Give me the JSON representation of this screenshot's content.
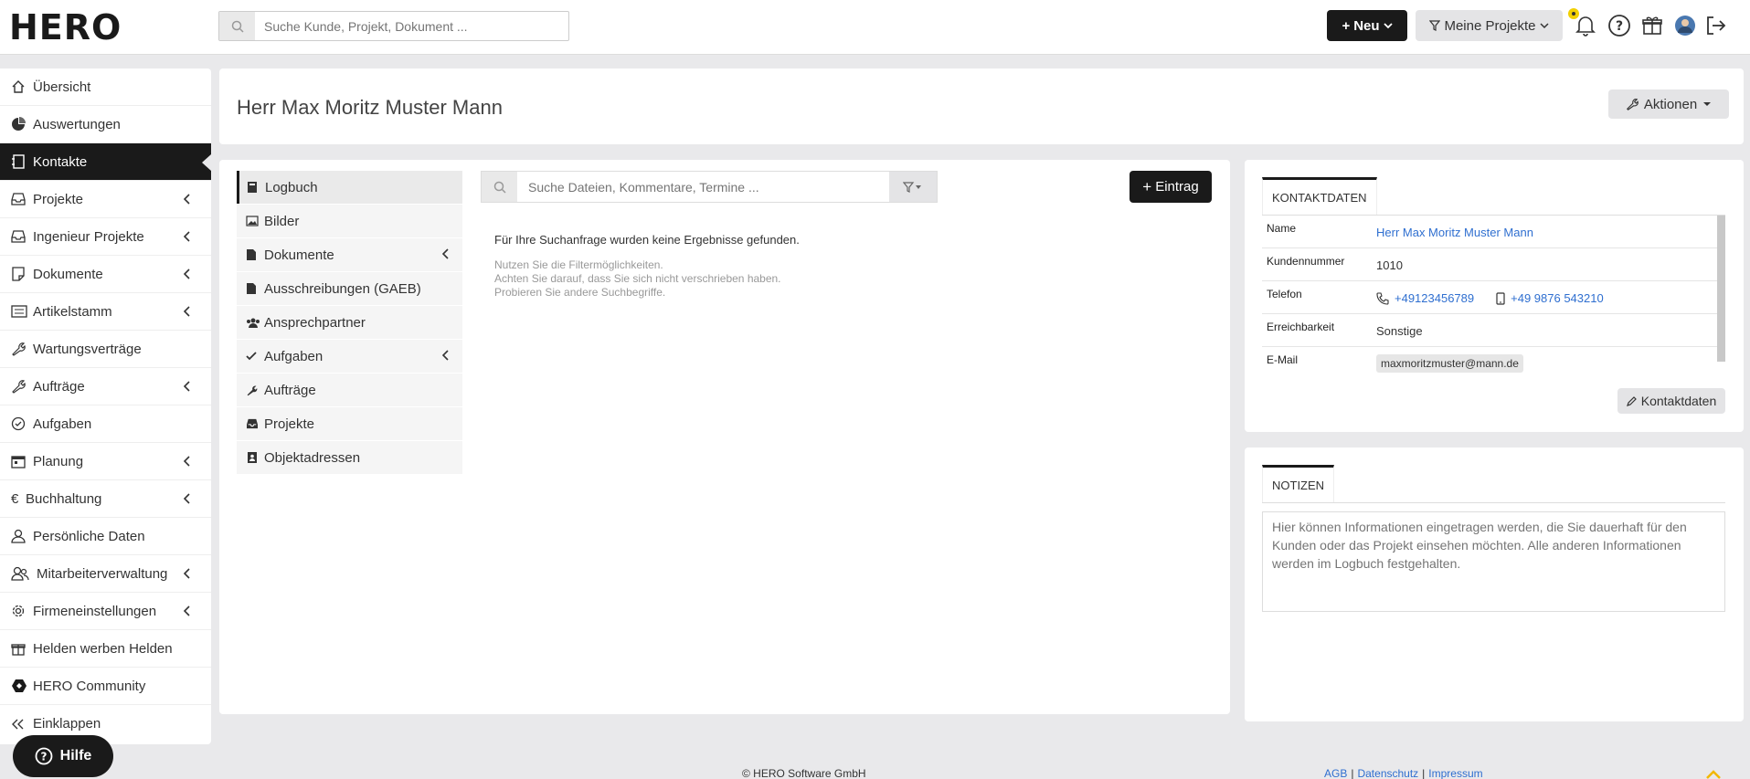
{
  "app": {
    "brand": "HERO"
  },
  "topbar": {
    "search_placeholder": "Suche Kunde, Projekt, Dokument ...",
    "new_label": "Neu",
    "projects_filter_label": "Meine Projekte"
  },
  "sidebar": {
    "items": [
      {
        "label": "Übersicht",
        "icon": "home-icon"
      },
      {
        "label": "Auswertungen",
        "icon": "pie-chart-icon"
      },
      {
        "label": "Kontakte",
        "icon": "contacts-icon",
        "active": true
      },
      {
        "label": "Projekte",
        "icon": "inbox-icon",
        "has_submenu": true
      },
      {
        "label": "Ingenieur Projekte",
        "icon": "inbox-icon",
        "has_submenu": true
      },
      {
        "label": "Dokumente",
        "icon": "document-icon",
        "has_submenu": true
      },
      {
        "label": "Artikelstamm",
        "icon": "list-icon",
        "has_submenu": true
      },
      {
        "label": "Wartungsverträge",
        "icon": "wrench-icon"
      },
      {
        "label": "Aufträge",
        "icon": "wrench-icon",
        "has_submenu": true
      },
      {
        "label": "Aufgaben",
        "icon": "check-circle-icon"
      },
      {
        "label": "Planung",
        "icon": "calendar-icon",
        "has_submenu": true
      },
      {
        "label": "Buchhaltung",
        "icon": "euro-icon",
        "has_submenu": true
      },
      {
        "label": "Persönliche Daten",
        "icon": "user-icon"
      },
      {
        "label": "Mitarbeiterverwaltung",
        "icon": "users-icon",
        "has_submenu": true
      },
      {
        "label": "Firmeneinstellungen",
        "icon": "gear-icon",
        "has_submenu": true
      },
      {
        "label": "Helden werben Helden",
        "icon": "gift-icon"
      },
      {
        "label": "HERO Community",
        "icon": "hero-logo-icon"
      },
      {
        "label": "Einklappen",
        "icon": "double-chevron-left-icon"
      }
    ],
    "help_label": "Hilfe"
  },
  "header": {
    "title": "Herr Max Moritz Muster Mann",
    "actions_label": "Aktionen"
  },
  "logbook": {
    "nav": [
      {
        "label": "Logbuch",
        "icon": "book-icon",
        "active": true
      },
      {
        "label": "Bilder",
        "icon": "image-icon"
      },
      {
        "label": "Dokumente",
        "icon": "file-icon",
        "has_submenu": true
      },
      {
        "label": "Ausschreibungen (GAEB)",
        "icon": "file-icon"
      },
      {
        "label": "Ansprechpartner",
        "icon": "users-icon"
      },
      {
        "label": "Aufgaben",
        "icon": "check-icon",
        "has_submenu": true
      },
      {
        "label": "Aufträge",
        "icon": "wrench-icon"
      },
      {
        "label": "Projekte",
        "icon": "inbox-icon"
      },
      {
        "label": "Objektadressen",
        "icon": "address-book-icon"
      }
    ],
    "search_placeholder": "Suche Dateien, Kommentare, Termine ...",
    "add_entry_label": "Eintrag",
    "no_results": "Für Ihre Suchanfrage wurden keine Ergebnisse gefunden.",
    "hints": [
      "Nutzen Sie die Filtermöglichkeiten.",
      "Achten Sie darauf, dass Sie sich nicht verschrieben haben.",
      "Probieren Sie andere Suchbegriffe."
    ]
  },
  "contact": {
    "tab_label": "KONTAKTDATEN",
    "rows": {
      "name_label": "Name",
      "name_value": "Herr Max Moritz Muster Mann",
      "customer_number_label": "Kundennummer",
      "customer_number_value": "1010",
      "phone_label": "Telefon",
      "phone_value": "+49123456789",
      "mobile_value": "+49 9876 543210",
      "reachability_label": "Erreichbarkeit",
      "reachability_value": "Sonstige",
      "email_label": "E-Mail",
      "email_value": "maxmoritzmuster@mann.de"
    },
    "edit_label": "Kontaktdaten"
  },
  "notes": {
    "tab_label": "NOTIZEN",
    "placeholder": "Hier können Informationen eingetragen werden, die Sie dauerhaft für den Kunden oder das Projekt einsehen möchten. Alle anderen Informationen werden im Logbuch festgehalten."
  },
  "footer": {
    "copyright": "© HERO Software GmbH",
    "links": [
      "AGB",
      "Datenschutz",
      "Impressum"
    ]
  },
  "colors": {
    "accent": "#1a1a1a",
    "link": "#2f6fd0",
    "notification": "#f2d000"
  }
}
